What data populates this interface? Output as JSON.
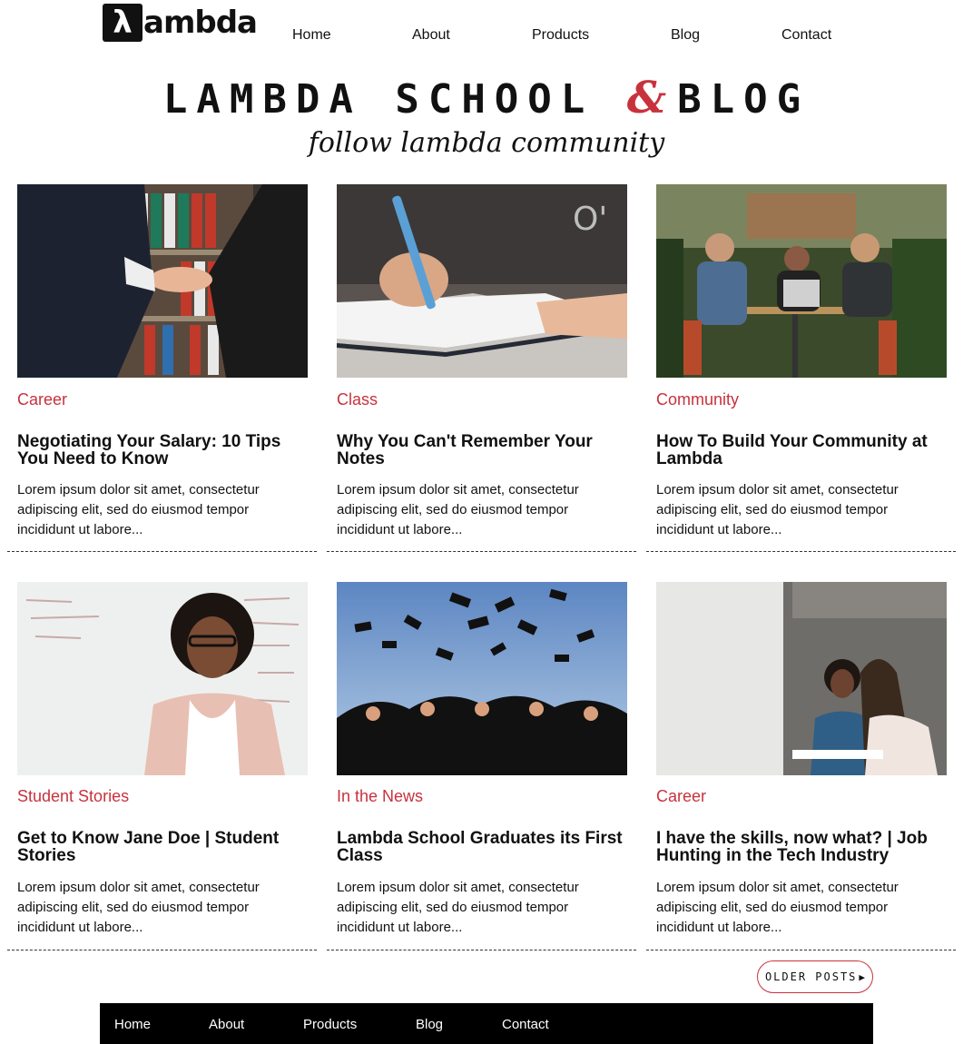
{
  "brand": {
    "logo_symbol": "λ",
    "logo_text": "ambda"
  },
  "top_nav": [
    "Home",
    "About",
    "Products",
    "Blog",
    "Contact"
  ],
  "hero": {
    "title_left": "LAMBDA SCHOOL",
    "title_amp": "&",
    "title_right": "BLOG",
    "subtitle": "follow lambda community"
  },
  "colors": {
    "accent": "#c8323d",
    "text": "#111111",
    "footer_bg": "#000000"
  },
  "posts": [
    {
      "category": "Career",
      "title": "Negotiating Your Salary: 10 Tips You Need to Know",
      "excerpt": "Lorem ipsum dolor sit amet, consectetur adipiscing elit, sed do eiusmod tempor incididunt ut labore...",
      "image": "handshake-photo"
    },
    {
      "category": "Class",
      "title": "Why You Can't Remember Your Notes",
      "excerpt": "Lorem ipsum dolor sit amet, consectetur adipiscing elit, sed do eiusmod tempor incididunt ut labore...",
      "image": "writing-notes-photo"
    },
    {
      "category": "Community",
      "title": "How To Build Your Community at Lambda",
      "excerpt": "Lorem ipsum dolor sit amet, consectetur adipiscing elit, sed do eiusmod tempor incididunt ut labore...",
      "image": "cafe-group-photo"
    },
    {
      "category": "Student Stories",
      "title": "Get to Know Jane Doe | Student Stories",
      "excerpt": "Lorem ipsum dolor sit amet, consectetur adipiscing elit, sed do eiusmod tempor incididunt ut labore...",
      "image": "student-portrait-photo"
    },
    {
      "category": "In the News",
      "title": "Lambda School Graduates its First Class",
      "excerpt": "Lorem ipsum dolor sit amet, consectetur adipiscing elit, sed do eiusmod tempor incididunt ut labore...",
      "image": "graduation-caps-photo"
    },
    {
      "category": "Career",
      "title": "I have the skills, now what? | Job Hunting in the Tech Industry",
      "excerpt": "Lorem ipsum dolor sit amet, consectetur adipiscing elit, sed do eiusmod tempor incididunt ut labore...",
      "image": "office-meeting-photo"
    }
  ],
  "older_posts": {
    "label": "OLDER POSTS",
    "icon": "play-arrow-icon"
  },
  "footer_nav": [
    "Home",
    "About",
    "Products",
    "Blog",
    "Contact"
  ]
}
